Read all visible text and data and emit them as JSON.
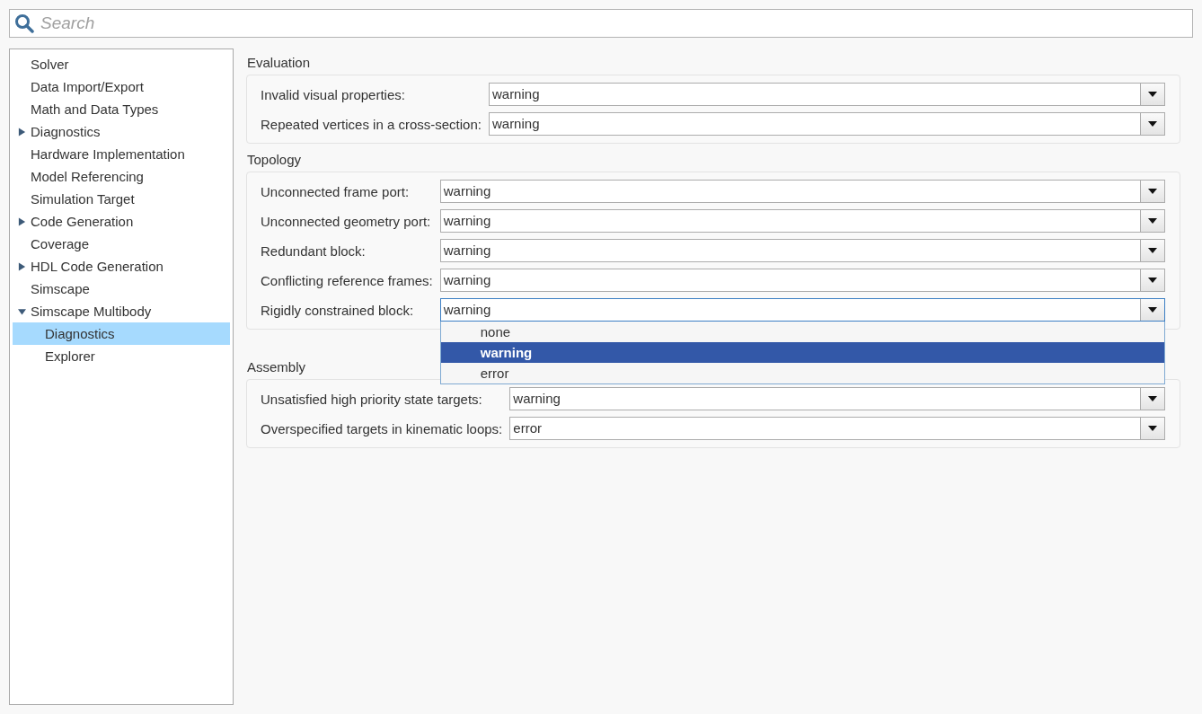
{
  "search": {
    "placeholder": "Search"
  },
  "sidebar": {
    "items": [
      {
        "label": "Solver",
        "selected": false
      },
      {
        "label": "Data Import/Export",
        "selected": false
      },
      {
        "label": "Math and Data Types",
        "selected": false
      },
      {
        "label": "Diagnostics",
        "selected": false,
        "expanded": false
      },
      {
        "label": "Hardware Implementation",
        "selected": false
      },
      {
        "label": "Model Referencing",
        "selected": false
      },
      {
        "label": "Simulation Target",
        "selected": false
      },
      {
        "label": "Code Generation",
        "selected": false,
        "expanded": false
      },
      {
        "label": "Coverage",
        "selected": false
      },
      {
        "label": "HDL Code Generation",
        "selected": false,
        "expanded": false
      },
      {
        "label": "Simscape",
        "selected": false
      },
      {
        "label": "Simscape Multibody",
        "selected": false,
        "expanded": true,
        "children": [
          {
            "label": "Diagnostics",
            "selected": true
          },
          {
            "label": "Explorer",
            "selected": false
          }
        ]
      }
    ]
  },
  "sections": [
    {
      "title": "Evaluation",
      "rows": [
        {
          "label": "Invalid visual properties:",
          "value": "warning"
        },
        {
          "label": "Repeated vertices in a cross-section:",
          "value": "warning"
        }
      ]
    },
    {
      "title": "Topology",
      "rows": [
        {
          "label": "Unconnected frame port:",
          "value": "warning"
        },
        {
          "label": "Unconnected geometry port:",
          "value": "warning"
        },
        {
          "label": "Redundant block:",
          "value": "warning"
        },
        {
          "label": "Conflicting reference frames:",
          "value": "warning"
        },
        {
          "label": "Rigidly constrained block:",
          "value": "warning",
          "open": true,
          "options": [
            {
              "label": "none",
              "selected": false
            },
            {
              "label": "warning",
              "selected": true
            },
            {
              "label": "error",
              "selected": false
            }
          ]
        }
      ]
    },
    {
      "title": "Assembly",
      "rows": [
        {
          "label": "Unsatisfied high priority state targets:",
          "value": "warning"
        },
        {
          "label": "Overspecified targets in kinematic loops:",
          "value": "error"
        }
      ]
    }
  ]
}
